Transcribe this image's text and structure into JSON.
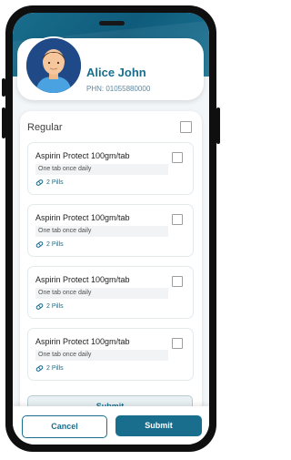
{
  "profile": {
    "name": "Alice John",
    "phn": "PHN: 01055880000"
  },
  "section": {
    "title": "Regular"
  },
  "medications": [
    {
      "name": "Aspirin Protect 100gm/tab",
      "dose": "One tab once daily",
      "pills": "2 Pills"
    },
    {
      "name": "Aspirin Protect 100gm/tab",
      "dose": "One tab once daily",
      "pills": "2 Pills"
    },
    {
      "name": "Aspirin Protect 100gm/tab",
      "dose": "One tab once daily",
      "pills": "2 Pills"
    },
    {
      "name": "Aspirin Protect 100gm/tab",
      "dose": "One tab once daily",
      "pills": "2 Pills"
    }
  ],
  "panel": {
    "submit_label": "Submit"
  },
  "footer": {
    "cancel_label": "Cancel",
    "submit_label": "Submit"
  },
  "colors": {
    "accent": "#1a6e8d",
    "header": "#0f5b7b",
    "background": "#f3f6f8"
  },
  "icons": [
    "avatar-icon",
    "pill-icon",
    "checkbox-icon"
  ]
}
